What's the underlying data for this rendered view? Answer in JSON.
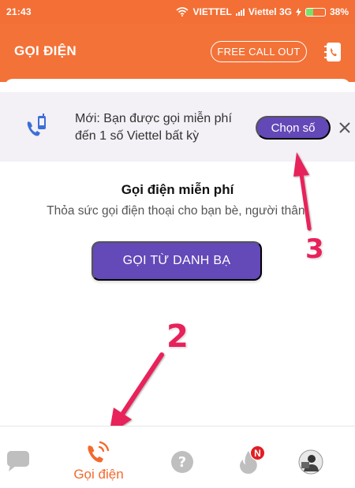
{
  "status_bar": {
    "time": "21:43",
    "carrier1": "VIETTEL",
    "carrier2": "Viettel 3G",
    "battery": "38%",
    "battery_level": 0.38
  },
  "header": {
    "title": "GỌI ĐIỆN",
    "free_call_label": "FREE CALL OUT",
    "contacts_icon": "contacts-phone-icon"
  },
  "banner": {
    "line1": "Mới: Bạn được gọi miễn phí",
    "line2": "đến 1 số Viettel bất kỳ",
    "action_label": "Chọn số",
    "icon": "phone-mobile-icon",
    "close_icon": "close-icon"
  },
  "promo": {
    "title": "Gọi điện miễn phí",
    "subtitle": "Thỏa sức gọi điện thoại cho bạn bè, người thân!",
    "button_label": "GỌI TỪ DANH BẠ"
  },
  "annotations": {
    "marker_2": "2",
    "marker_3": "3"
  },
  "bottom_nav": {
    "items": [
      {
        "icon": "chat-icon",
        "label": ""
      },
      {
        "icon": "phone-call-icon",
        "label": "Gọi điện",
        "active": true
      },
      {
        "icon": "help-icon",
        "label": ""
      },
      {
        "icon": "fire-icon",
        "label": "",
        "badge": "N"
      },
      {
        "icon": "avatar-icon",
        "label": ""
      }
    ]
  },
  "colors": {
    "brand_orange": "#f37238",
    "accent_purple": "#6449b9",
    "annotation_pink": "#e8215a"
  }
}
